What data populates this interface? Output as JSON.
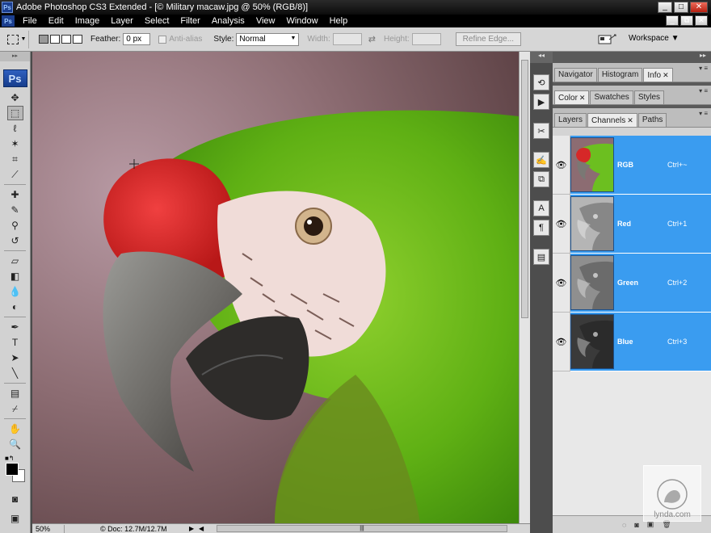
{
  "window": {
    "title": "Adobe Photoshop CS3 Extended - [© Military macaw.jpg @ 50% (RGB/8)]",
    "logo": "Ps",
    "controls": [
      "_",
      "□",
      "✕"
    ]
  },
  "menubar": {
    "items": [
      "File",
      "Edit",
      "Image",
      "Layer",
      "Select",
      "Filter",
      "Analysis",
      "View",
      "Window",
      "Help"
    ],
    "mdi_controls": [
      "_",
      "⧉",
      "✕"
    ]
  },
  "options": {
    "feather_label": "Feather:",
    "feather_value": "0 px",
    "antialias_label": "Anti-alias",
    "style_label": "Style:",
    "style_value": "Normal",
    "width_label": "Width:",
    "height_label": "Height:",
    "refine_edge": "Refine Edge...",
    "workspace": "Workspace ▼"
  },
  "toolbox": {
    "badge": "Ps",
    "tools": [
      {
        "name": "move-tool",
        "glyph": "✥"
      },
      {
        "name": "marquee-tool",
        "glyph": "⬚"
      },
      {
        "name": "lasso-tool",
        "glyph": "ℓ"
      },
      {
        "name": "magic-wand-tool",
        "glyph": "✶"
      },
      {
        "name": "crop-tool",
        "glyph": "⌗"
      },
      {
        "name": "slice-tool",
        "glyph": "⟋"
      },
      {
        "name": "healing-brush-tool",
        "glyph": "✚"
      },
      {
        "name": "brush-tool",
        "glyph": "✎"
      },
      {
        "name": "clone-stamp-tool",
        "glyph": "⚲"
      },
      {
        "name": "history-brush-tool",
        "glyph": "↺"
      },
      {
        "name": "eraser-tool",
        "glyph": "▱"
      },
      {
        "name": "gradient-tool",
        "glyph": "◧"
      },
      {
        "name": "blur-tool",
        "glyph": "💧"
      },
      {
        "name": "dodge-tool",
        "glyph": "◐"
      },
      {
        "name": "pen-tool",
        "glyph": "✒"
      },
      {
        "name": "type-tool",
        "glyph": "T"
      },
      {
        "name": "path-selection-tool",
        "glyph": "➤"
      },
      {
        "name": "line-tool",
        "glyph": "╲"
      },
      {
        "name": "notes-tool",
        "glyph": "▤"
      },
      {
        "name": "eyedropper-tool",
        "glyph": "⌿"
      },
      {
        "name": "hand-tool",
        "glyph": "✋"
      },
      {
        "name": "zoom-tool",
        "glyph": "🔍"
      }
    ],
    "bottom_tools": [
      {
        "name": "quick-mask-tool",
        "glyph": "◙"
      },
      {
        "name": "screen-mode-tool",
        "glyph": "▣"
      }
    ]
  },
  "status": {
    "zoom": "50%",
    "doc": "Doc: 12.7M/12.7M"
  },
  "dock": {
    "buttons": [
      {
        "name": "history-icon",
        "glyph": "⟲"
      },
      {
        "name": "actions-icon",
        "glyph": "▶"
      },
      {
        "name": "tool-presets-icon",
        "glyph": "✂"
      },
      {
        "name": "brushes-icon",
        "glyph": "✍"
      },
      {
        "name": "clone-source-icon",
        "glyph": "⧉"
      },
      {
        "name": "character-icon",
        "glyph": "A"
      },
      {
        "name": "paragraph-icon",
        "glyph": "¶"
      },
      {
        "name": "layer-comps-icon",
        "glyph": "▤"
      }
    ]
  },
  "panels": {
    "group1": [
      "Navigator",
      "Histogram",
      "Info"
    ],
    "group1_active": "Info",
    "group2": [
      "Color",
      "Swatches",
      "Styles"
    ],
    "group2_active": "Color",
    "group3": [
      "Layers",
      "Channels",
      "Paths"
    ],
    "group3_active": "Channels"
  },
  "channels": [
    {
      "name": "RGB",
      "shortcut": "Ctrl+~",
      "thumb": "color"
    },
    {
      "name": "Red",
      "shortcut": "Ctrl+1",
      "thumb": "#b5b5b5"
    },
    {
      "name": "Green",
      "shortcut": "Ctrl+2",
      "thumb": "#8f8f8f"
    },
    {
      "name": "Blue",
      "shortcut": "Ctrl+3",
      "thumb": "#3a3a3a"
    }
  ],
  "watermark": "lynda.com"
}
